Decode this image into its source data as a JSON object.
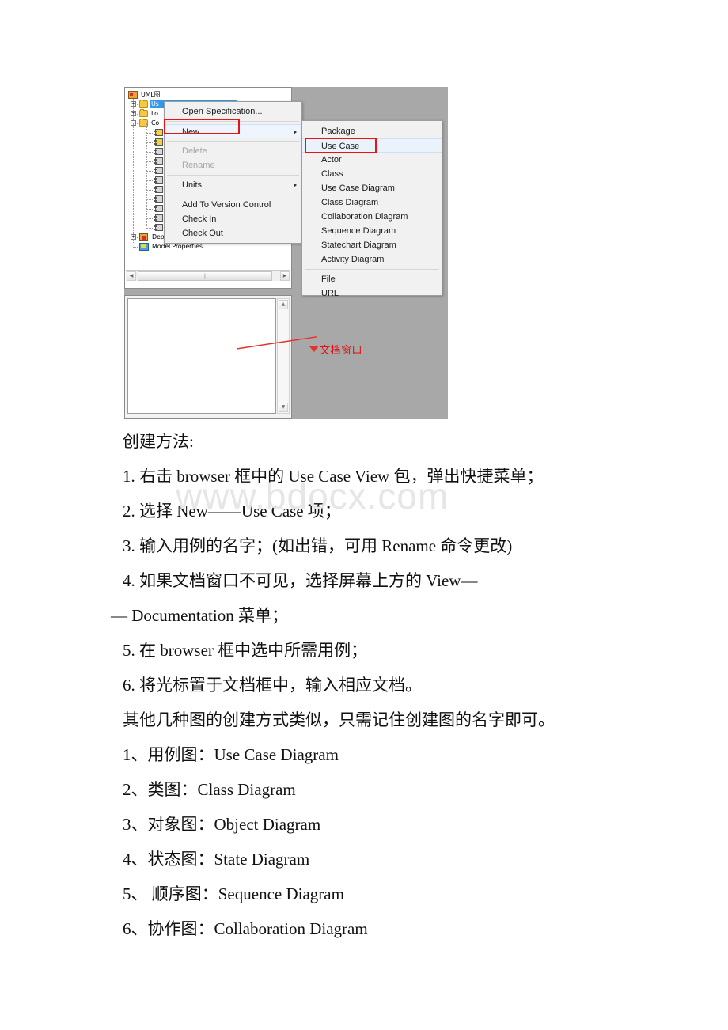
{
  "screenshot": {
    "browser": {
      "root_label": "UML图",
      "tree_items": [
        {
          "label": "Use Case View",
          "short": "Us",
          "type": "folder",
          "selected": true
        },
        {
          "label": "Logical View",
          "short": "Lo",
          "type": "folder",
          "selected": false
        },
        {
          "label": "Component View",
          "short": "Co",
          "type": "folder",
          "selected": false
        }
      ],
      "bottom_items": [
        {
          "label": "Deployment View",
          "type": "deployment"
        },
        {
          "label": "Model Properties",
          "type": "properties"
        }
      ],
      "scrollbar": {
        "left_arrow": "◀",
        "right_arrow": "▶",
        "grip": "|||"
      }
    },
    "documentation": {
      "text": "",
      "scroll_up": "▲",
      "scroll_down": "▼"
    },
    "context_menu": {
      "items": [
        {
          "label": "Open Specification...",
          "disabled": false,
          "submenu": false,
          "highlighted": false
        },
        {
          "label": "New",
          "disabled": false,
          "submenu": true,
          "highlighted": true
        },
        {
          "label": "Delete",
          "disabled": true,
          "submenu": false,
          "highlighted": false
        },
        {
          "label": "Rename",
          "disabled": true,
          "submenu": false,
          "highlighted": false
        },
        {
          "label": "Units",
          "disabled": false,
          "submenu": true,
          "highlighted": false
        },
        {
          "label": "Add To Version Control",
          "disabled": false,
          "submenu": false,
          "highlighted": false
        },
        {
          "label": "Check In",
          "disabled": false,
          "submenu": false,
          "highlighted": false
        },
        {
          "label": "Check Out",
          "disabled": false,
          "submenu": false,
          "highlighted": false
        }
      ]
    },
    "submenu": {
      "items": [
        {
          "label": "Package",
          "highlighted": false
        },
        {
          "label": "Use Case",
          "highlighted": true
        },
        {
          "label": "Actor",
          "highlighted": false
        },
        {
          "label": "Class",
          "highlighted": false
        },
        {
          "label": "Use Case Diagram",
          "highlighted": false
        },
        {
          "label": "Class Diagram",
          "highlighted": false
        },
        {
          "label": "Collaboration Diagram",
          "highlighted": false
        },
        {
          "label": "Sequence Diagram",
          "highlighted": false
        },
        {
          "label": "Statechart Diagram",
          "highlighted": false
        },
        {
          "label": "Activity Diagram",
          "highlighted": false
        }
      ],
      "items_tail": [
        {
          "label": "File",
          "highlighted": false
        },
        {
          "label": "URL",
          "highlighted": false
        }
      ]
    },
    "annotation": {
      "label": "文档窗口",
      "color": "#e01010"
    },
    "highlight_color": "#ee1111",
    "selection_color": "#3399e8",
    "panel_bg": "#a8a8a8"
  },
  "document": {
    "heading": "创建方法:",
    "steps": [
      "1. 右击 browser 框中的 Use Case View 包，弹出快捷菜单；",
      "2. 选择 New——Use Case 项；",
      "3. 输入用例的名字；(如出错，可用 Rename 命令更改)",
      "4. 如果文档窗口不可见，选择屏幕上方的 View—",
      "— Documentation 菜单；",
      "5. 在 browser 框中选中所需用例；",
      "6. 将光标置于文档框中，输入相应文档。",
      "其他几种图的创建方式类似，只需记住创建图的名字即可。"
    ],
    "diagram_list": [
      "1、用例图：Use Case Diagram",
      "2、类图：Class Diagram",
      "3、对象图：Object Diagram",
      "4、状态图：State Diagram",
      "5、 顺序图：Sequence Diagram",
      "6、协作图：Collaboration Diagram"
    ]
  },
  "watermark": {
    "text": "www.bdocx.com"
  }
}
